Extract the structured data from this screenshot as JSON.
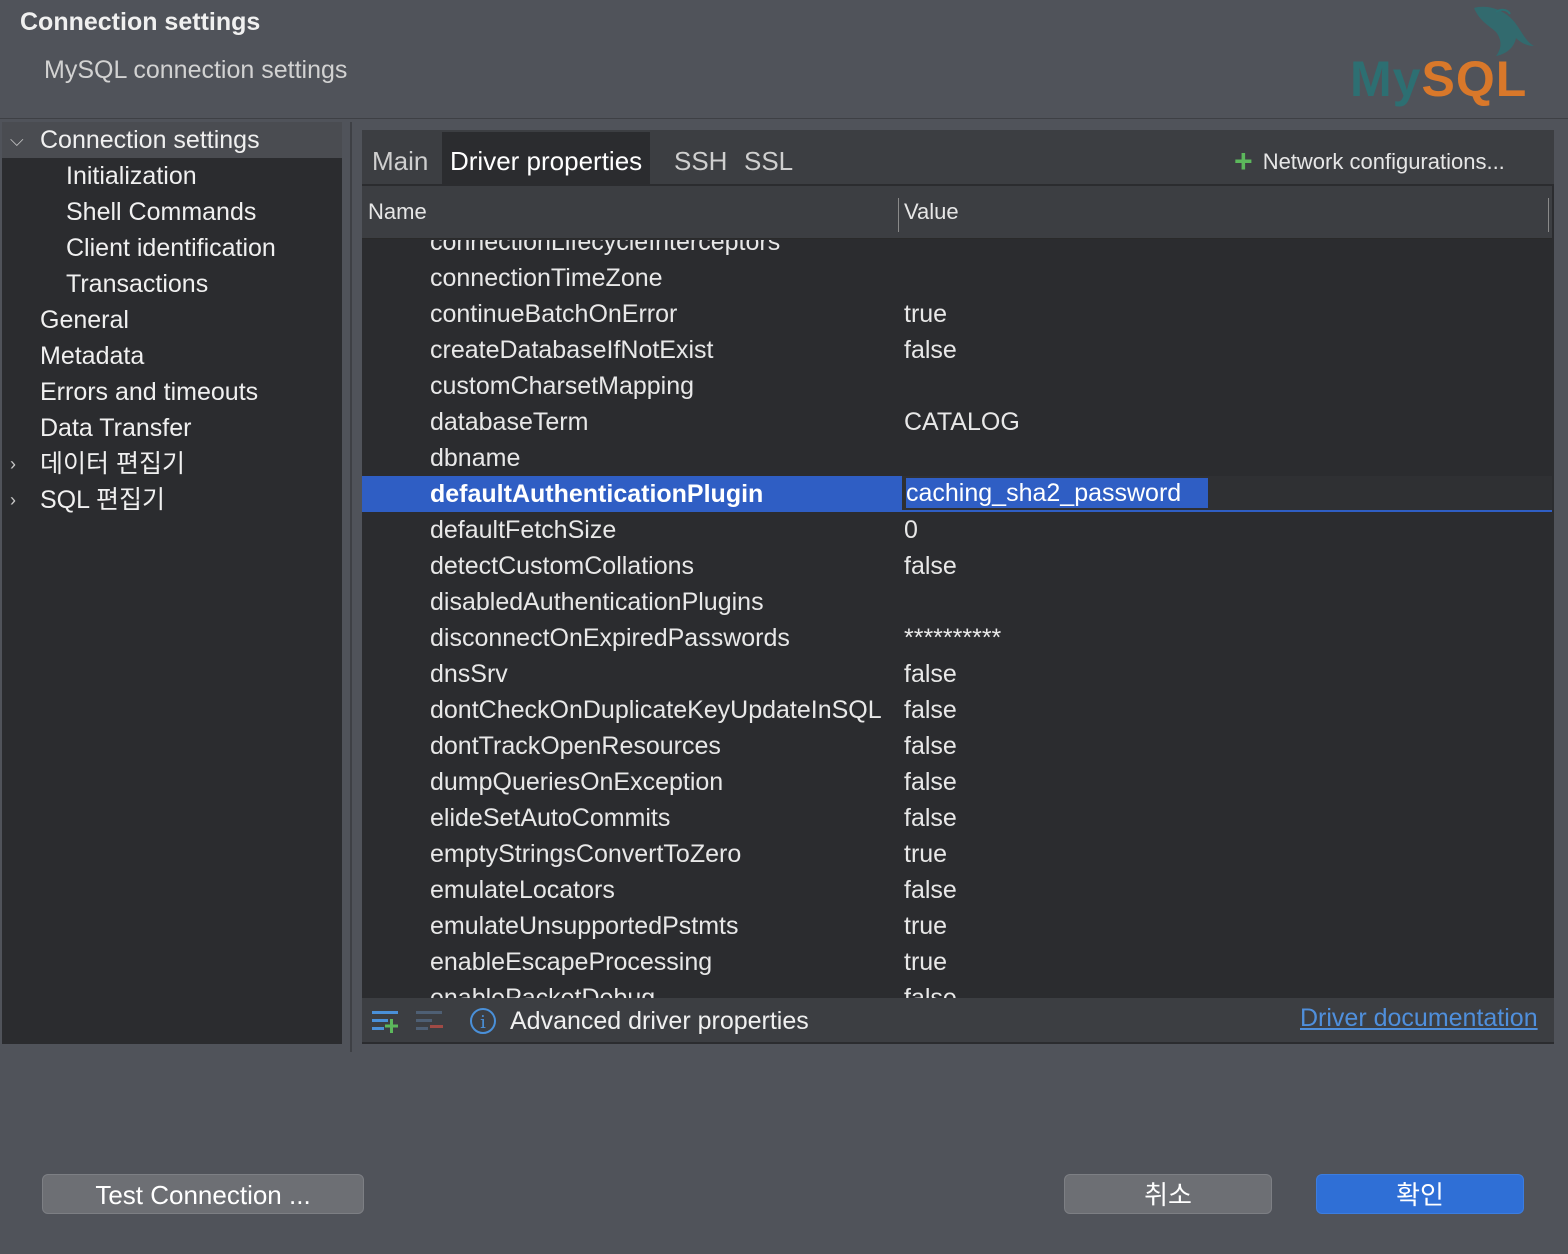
{
  "header": {
    "title": "Connection settings",
    "subtitle": "MySQL connection settings",
    "logo_my": "My",
    "logo_sql": "SQL"
  },
  "sidebar": {
    "items": [
      {
        "label": "Connection settings",
        "expanded": true,
        "selected": true
      },
      {
        "label": "Initialization"
      },
      {
        "label": "Shell Commands"
      },
      {
        "label": "Client identification"
      },
      {
        "label": "Transactions"
      },
      {
        "label": "General"
      },
      {
        "label": "Metadata"
      },
      {
        "label": "Errors and timeouts"
      },
      {
        "label": "Data Transfer"
      },
      {
        "label": "데이터 편집기",
        "collapsed": true
      },
      {
        "label": "SQL 편집기",
        "collapsed": true
      }
    ]
  },
  "tabs": [
    {
      "label": "Main"
    },
    {
      "label": "Driver properties",
      "active": true
    },
    {
      "label": "SSH"
    },
    {
      "label": "SSL"
    }
  ],
  "network_configurations": "Network configurations...",
  "table": {
    "columns": [
      "Name",
      "Value"
    ],
    "rows": [
      {
        "name": "connectionLifecycleInterceptors",
        "value": ""
      },
      {
        "name": "connectionTimeZone",
        "value": ""
      },
      {
        "name": "continueBatchOnError",
        "value": "true"
      },
      {
        "name": "createDatabaseIfNotExist",
        "value": "false"
      },
      {
        "name": "customCharsetMapping",
        "value": ""
      },
      {
        "name": "databaseTerm",
        "value": "CATALOG"
      },
      {
        "name": "dbname",
        "value": ""
      },
      {
        "name": "defaultAuthenticationPlugin",
        "value": "caching_sha2_password",
        "selected": true,
        "editing": true
      },
      {
        "name": "defaultFetchSize",
        "value": "0"
      },
      {
        "name": "detectCustomCollations",
        "value": "false"
      },
      {
        "name": "disabledAuthenticationPlugins",
        "value": ""
      },
      {
        "name": "disconnectOnExpiredPasswords",
        "value": "**********"
      },
      {
        "name": "dnsSrv",
        "value": "false"
      },
      {
        "name": "dontCheckOnDuplicateKeyUpdateInSQL",
        "value": "false"
      },
      {
        "name": "dontTrackOpenResources",
        "value": "false"
      },
      {
        "name": "dumpQueriesOnException",
        "value": "false"
      },
      {
        "name": "elideSetAutoCommits",
        "value": "false"
      },
      {
        "name": "emptyStringsConvertToZero",
        "value": "true"
      },
      {
        "name": "emulateLocators",
        "value": "false"
      },
      {
        "name": "emulateUnsupportedPstmts",
        "value": "true"
      },
      {
        "name": "enableEscapeProcessing",
        "value": "true"
      },
      {
        "name": "enablePacketDebug",
        "value": "false"
      }
    ]
  },
  "bottom": {
    "advanced_label": "Advanced driver properties",
    "doc_link": "Driver documentation"
  },
  "buttons": {
    "test_connection": "Test Connection ...",
    "cancel": "취소",
    "ok": "확인"
  },
  "colors": {
    "accent": "#2f5ec4",
    "ok_button": "#2f6fd6",
    "link": "#4f8fdc",
    "add_icon": "#5cb85c",
    "remove_icon": "#d9534f"
  }
}
